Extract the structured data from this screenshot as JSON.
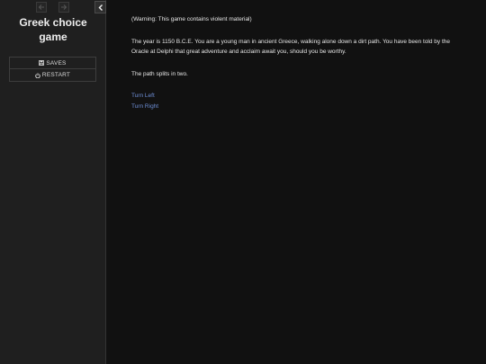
{
  "sidebar": {
    "story_title_line1": "Greek choice",
    "story_title_line2": "game",
    "history_back_icon": "arrow-left-icon",
    "history_forward_icon": "arrow-right-icon",
    "collapse_icon": "chevron-left-icon",
    "menu": [
      {
        "label": "SAVES",
        "icon": "floppy-disk-icon"
      },
      {
        "label": "RESTART",
        "icon": "power-icon"
      }
    ]
  },
  "passage": {
    "warning": "(Warning: This game contains violent material)",
    "intro": "The year is 1150 B.C.E. You are a young man in ancient Greece, walking alone down a dirt path. You have been told by the Oracle at Delphi that great adventure and acclaim await you, should you be worthy.",
    "split": "The path splits in two.",
    "choices": [
      {
        "label": "Turn Left"
      },
      {
        "label": "Turn Right"
      }
    ]
  },
  "colors": {
    "background": "#111111",
    "sidebar": "#1f1f1f",
    "text": "#e6e6e6",
    "link": "#6e8fd6"
  }
}
